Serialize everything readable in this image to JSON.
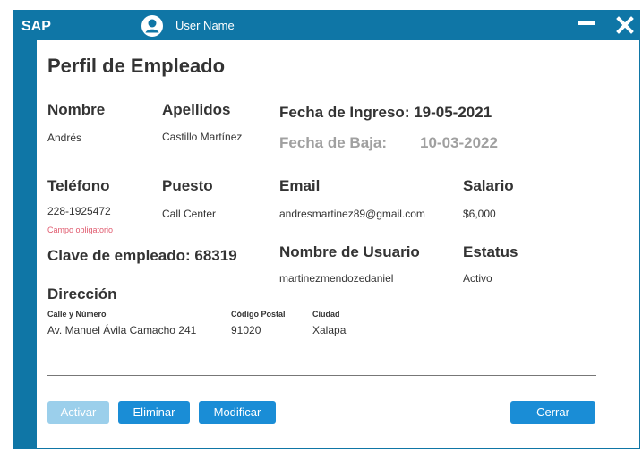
{
  "titlebar": {
    "brand": "SAP",
    "user_name": "User Name",
    "icons": {
      "user": "user-icon",
      "minimize": "minimize-icon",
      "close": "close-icon"
    }
  },
  "page": {
    "title": "Perfil de Empleado"
  },
  "employee": {
    "nombre_label": "Nombre",
    "nombre": "Andrés",
    "apellidos_label": "Apellidos",
    "apellidos": "Castillo Martínez",
    "fecha_ingreso": "Fecha de Ingreso: 19-05-2021",
    "fecha_baja_label": "Fecha de Baja:",
    "fecha_baja": "10-03-2022",
    "telefono_label": "Teléfono",
    "telefono": "228-1925472",
    "telefono_error": "Campo obligatorio",
    "puesto_label": "Puesto",
    "puesto": "Call Center",
    "email_label": "Email",
    "email": "andresmartinez89@gmail.com",
    "salario_label": "Salario",
    "salario": "$6,000",
    "clave": "Clave de empleado: 68319",
    "usuario_label": "Nombre de Usuario",
    "usuario": "martinezmendozedaniel",
    "estatus_label": "Estatus",
    "estatus": "Activo",
    "direccion_label": "Dirección",
    "calle_label": "Calle y Número",
    "calle": "Av. Manuel Ávila Camacho 241",
    "cp_label": "Código Postal",
    "cp": "91020",
    "ciudad_label": "Ciudad",
    "ciudad": "Xalapa"
  },
  "actions": {
    "activar": "Activar",
    "eliminar": "Eliminar",
    "modificar": "Modificar",
    "cerrar": "Cerrar"
  },
  "colors": {
    "primary": "#0f76a6",
    "button": "#1a8dd6",
    "button_disabled": "#9bcfeb",
    "error": "#e05a6e"
  }
}
